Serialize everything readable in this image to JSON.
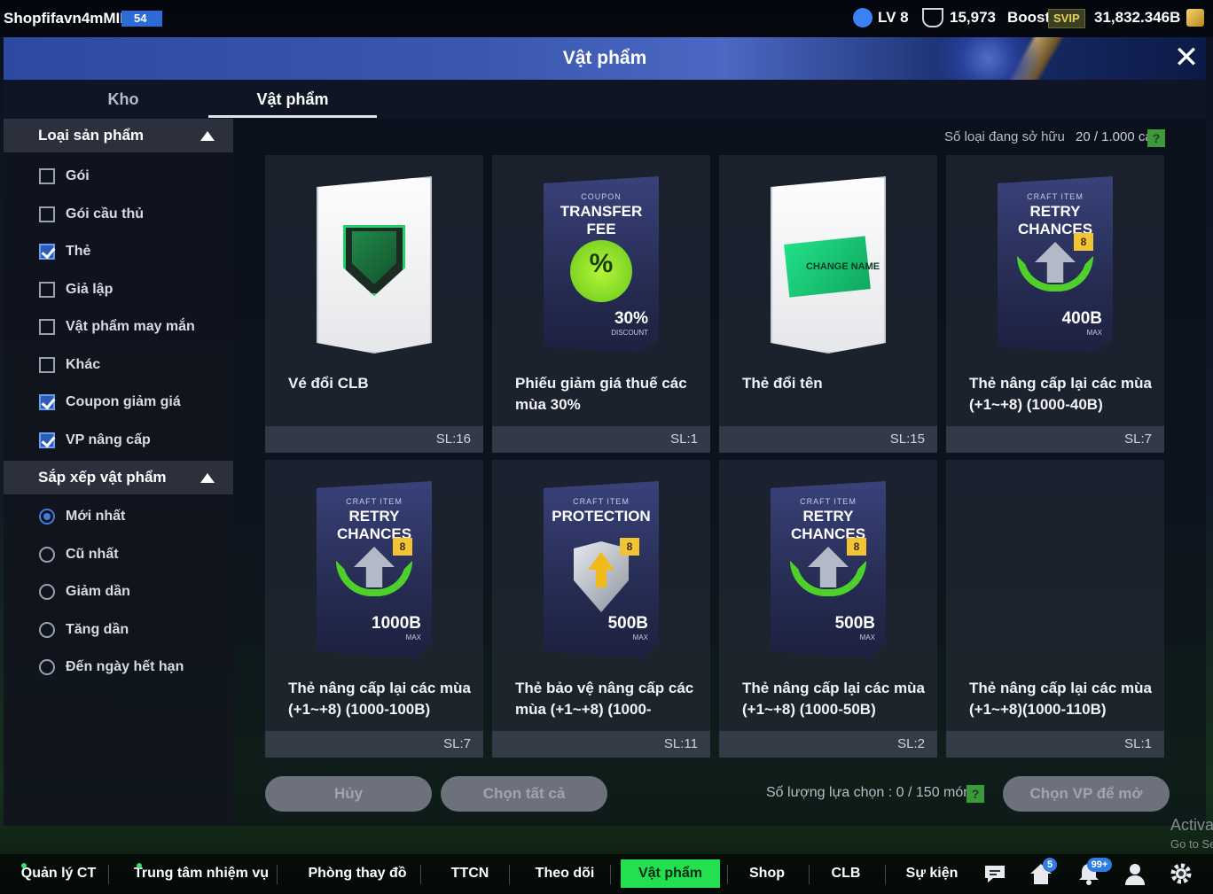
{
  "topbar": {
    "username": "Shopfifavn4mMIL",
    "user_level": "54",
    "lv": "LV 8",
    "trophy": "15,973",
    "boost": "Boost",
    "svip": "SVIP",
    "coins": "31,832.346B"
  },
  "header": {
    "title": "Vật phẩm"
  },
  "tabs": [
    {
      "label": "Kho"
    },
    {
      "label": "Vật phẩm"
    }
  ],
  "sidebar": {
    "filter_title": "Loại sản phẩm",
    "filters": [
      {
        "label": "Gói",
        "checked": false
      },
      {
        "label": "Gói cầu thủ",
        "checked": false
      },
      {
        "label": "Thẻ",
        "checked": true
      },
      {
        "label": "Giả lập",
        "checked": false
      },
      {
        "label": "Vật phẩm may mắn",
        "checked": false
      },
      {
        "label": "Khác",
        "checked": false
      },
      {
        "label": "Coupon giảm giá",
        "checked": true
      },
      {
        "label": "VP nâng cấp",
        "checked": true
      }
    ],
    "sort_title": "Sắp xếp vật phẩm",
    "sorts": [
      {
        "label": "Mới nhất",
        "selected": true
      },
      {
        "label": "Cũ nhất",
        "selected": false
      },
      {
        "label": "Giảm dần",
        "selected": false
      },
      {
        "label": "Tăng dần",
        "selected": false
      },
      {
        "label": "Đến ngày hết hạn",
        "selected": false
      }
    ]
  },
  "main": {
    "owned_label": "Số loại đang sở hữu",
    "owned_count": "20 / 1.000 cái",
    "help": "?",
    "items": [
      {
        "name": "Vé đổi CLB",
        "qty": "SL:16",
        "art": "club-ticket"
      },
      {
        "name": "Phiếu giảm giá thuế các mùa 30%",
        "qty": "SL:1",
        "art": "coupon",
        "small": "COUPON",
        "big": "TRANSFER FEE",
        "badge": "%",
        "value": "30%",
        "value_sub": "DISCOUNT"
      },
      {
        "name": "Thẻ đổi tên",
        "qty": "SL:15",
        "art": "change-name",
        "tag": "CHANGE NAME"
      },
      {
        "name": "Thẻ nâng cấp lại các mùa (+1~+8) (1000-40B)",
        "qty": "SL:7",
        "art": "retry",
        "small": "CRAFT ITEM",
        "big": "RETRY CHANCES",
        "level": "8",
        "value": "400B",
        "value_sub": "MAX"
      },
      {
        "name": "Thẻ nâng cấp lại các mùa (+1~+8) (1000-100B)",
        "qty": "SL:7",
        "art": "retry",
        "small": "CRAFT ITEM",
        "big": "RETRY CHANCES",
        "level": "8",
        "value": "1000B",
        "value_sub": "MAX"
      },
      {
        "name": "Thẻ bảo vệ nâng cấp các mùa (+1~+8) (1000-",
        "qty": "SL:11",
        "art": "protection",
        "small": "CRAFT ITEM",
        "big": "PROTECTION",
        "level": "8",
        "value": "500B",
        "value_sub": "MAX"
      },
      {
        "name": "Thẻ nâng cấp lại các mùa (+1~+8) (1000-50B)",
        "qty": "SL:2",
        "art": "retry",
        "small": "CRAFT ITEM",
        "big": "RETRY CHANCES",
        "level": "8",
        "value": "500B",
        "value_sub": "MAX"
      },
      {
        "name": "Thẻ nâng cấp lại các mùa (+1~+8)(1000-110B)",
        "qty": "SL:1",
        "art": "none"
      }
    ],
    "cancel_label": "Hủy",
    "select_all_label": "Chọn tất cả",
    "selection_label": "Số lượng lựa chọn : 0 / 150 món",
    "open_label": "Chọn VP để mở"
  },
  "bottomnav": {
    "items": [
      {
        "label": "Quản lý CT",
        "active": false
      },
      {
        "label": "Trung tâm nhiệm vụ",
        "active": false
      },
      {
        "label": "Phòng thay đồ",
        "active": false
      },
      {
        "label": "TTCN",
        "active": false
      },
      {
        "label": "Theo dõi",
        "active": false
      },
      {
        "label": "Vật phẩm",
        "active": true
      },
      {
        "label": "Shop",
        "active": false
      },
      {
        "label": "CLB",
        "active": false
      },
      {
        "label": "Sự kiện",
        "active": false
      }
    ],
    "home_badge": "5",
    "notif_badge": "99+"
  },
  "watermark": {
    "line1": "Activate Windows",
    "line2": "Go to Settings to activate Windows."
  },
  "colors": {
    "accent": "#23e050",
    "checkbox": "#2a5db8",
    "header": "#3a58b0"
  }
}
